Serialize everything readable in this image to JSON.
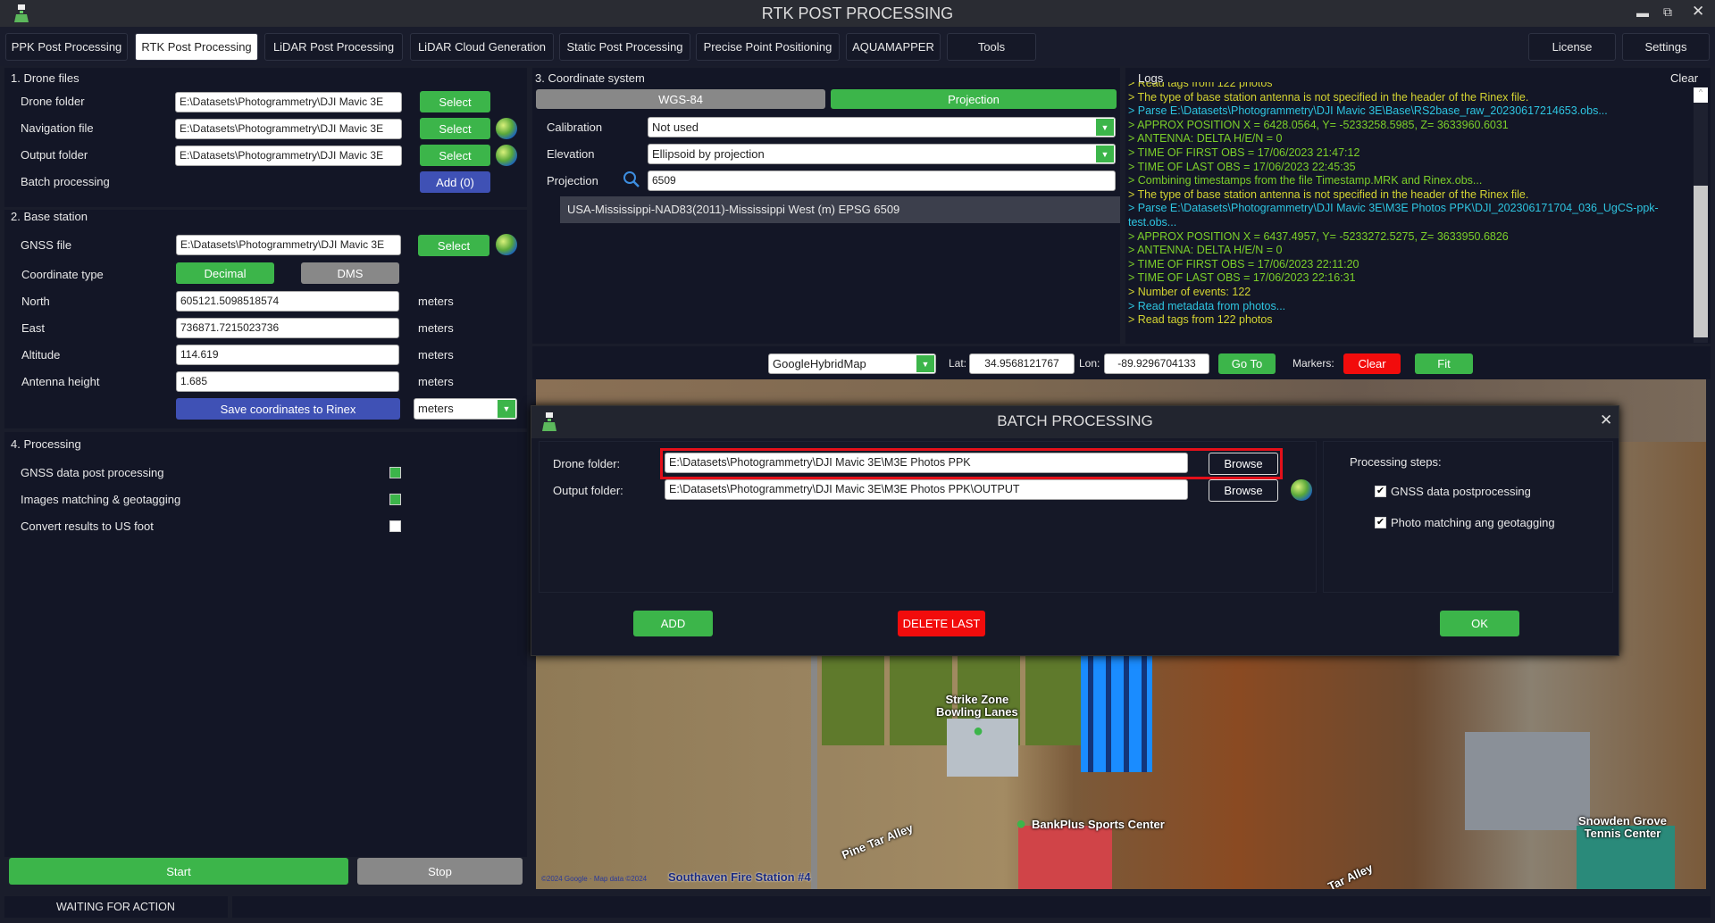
{
  "window": {
    "title": "RTK POST PROCESSING",
    "controls": [
      "minimize",
      "restore",
      "close"
    ]
  },
  "tabs": [
    {
      "label": "PPK Post Processing"
    },
    {
      "label": "RTK Post Processing",
      "active": true
    },
    {
      "label": "LiDAR Post Processing"
    },
    {
      "label": "LiDAR Cloud Generation"
    },
    {
      "label": "Static Post Processing"
    },
    {
      "label": "Precise Point Positioning"
    },
    {
      "label": "AQUAMAPPER"
    },
    {
      "label": "Tools"
    }
  ],
  "right_tabs": {
    "license": "License",
    "settings": "Settings"
  },
  "drone_files": {
    "title": "1. Drone files",
    "drone_folder_label": "Drone folder",
    "drone_folder": "E:\\Datasets\\Photogrammetry\\DJI Mavic 3E",
    "nav_label": "Navigation file",
    "nav_file": "E:\\Datasets\\Photogrammetry\\DJI Mavic 3E",
    "output_label": "Output folder",
    "output_folder": "E:\\Datasets\\Photogrammetry\\DJI Mavic 3E",
    "batch_label": "Batch processing",
    "select": "Select",
    "add": "Add (0)"
  },
  "base_station": {
    "title": "2. Base station",
    "gnss_label": "GNSS file",
    "gnss_file": "E:\\Datasets\\Photogrammetry\\DJI Mavic 3E",
    "select": "Select",
    "coord_type_label": "Coordinate type",
    "decimal": "Decimal",
    "dms": "DMS",
    "north_label": "North",
    "north": "605121.5098518574",
    "east_label": "East",
    "east": "736871.7215023736",
    "alt_label": "Altitude",
    "alt": "114.619",
    "ant_label": "Antenna height",
    "ant": "1.685",
    "unit": "meters",
    "save": "Save coordinates to Rinex",
    "unit_select": "meters"
  },
  "processing": {
    "title": "4. Processing",
    "items": [
      {
        "label": "GNSS data post processing",
        "checked": true
      },
      {
        "label": "Images matching & geotagging",
        "checked": true
      },
      {
        "label": "Convert results to US foot",
        "checked": false
      }
    ],
    "start": "Start",
    "stop": "Stop"
  },
  "status": "WAITING FOR ACTION",
  "coord_system": {
    "title": "3. Coordinate system",
    "wgs": "WGS-84",
    "projection_btn": "Projection",
    "calibration_label": "Calibration",
    "calibration": "Not used",
    "elevation_label": "Elevation",
    "elevation": "Ellipsoid by projection",
    "projection_label": "Projection",
    "projection": "6509",
    "result": "USA-Mississippi-NAD83(2011)-Mississippi West (m) EPSG 6509"
  },
  "logs": {
    "title": "Logs",
    "clear": "Clear",
    "lines": [
      {
        "text": "> Read tags from 122 photos",
        "color": "#d4d432"
      },
      {
        "text": "> The type of base station antenna is not specified in the header of the Rinex file.",
        "color": "#d4d432"
      },
      {
        "text": "> Parse E:\\Datasets\\Photogrammetry\\DJI Mavic 3E\\Base\\RS2base_raw_20230617214653.obs...",
        "color": "#2ec4e0"
      },
      {
        "text": "> APPROX POSITION X = 6428.0564, Y= -5233258.5985, Z= 3633960.6031",
        "color": "#7ccf2a"
      },
      {
        "text": "> ANTENNA: DELTA H/E/N = 0",
        "color": "#7ccf2a"
      },
      {
        "text": "> TIME OF FIRST OBS = 17/06/2023 21:47:12",
        "color": "#7ccf2a"
      },
      {
        "text": "> TIME OF LAST OBS = 17/06/2023 22:45:35",
        "color": "#7ccf2a"
      },
      {
        "text": "> Combining timestamps from the file Timestamp.MRK and Rinex.obs...",
        "color": "#7ccf2a"
      },
      {
        "text": "> The type of base station antenna is not specified in the header of the Rinex file.",
        "color": "#d4d432"
      },
      {
        "text": "> Parse E:\\Datasets\\Photogrammetry\\DJI Mavic 3E\\M3E Photos PPK\\DJI_202306171704_036_UgCS-ppk-",
        "color": "#2ec4e0"
      },
      {
        "text": "test.obs...",
        "color": "#2ec4e0"
      },
      {
        "text": "> APPROX POSITION X = 6437.4957, Y= -5233272.5275, Z= 3633950.6826",
        "color": "#7ccf2a"
      },
      {
        "text": "> ANTENNA: DELTA H/E/N = 0",
        "color": "#7ccf2a"
      },
      {
        "text": "> TIME OF FIRST OBS = 17/06/2023 22:11:20",
        "color": "#7ccf2a"
      },
      {
        "text": "> TIME OF LAST OBS = 17/06/2023 22:16:31",
        "color": "#7ccf2a"
      },
      {
        "text": "> Number of events: 122",
        "color": "#d4d432"
      },
      {
        "text": "> Read metadata from photos...",
        "color": "#2ec4e0"
      },
      {
        "text": "> Read tags from 122 photos",
        "color": "#d4d432"
      }
    ]
  },
  "map_toolbar": {
    "map_type": "GoogleHybridMap",
    "lat_label": "Lat:",
    "lat": "34.9568121767",
    "lon_label": "Lon:",
    "lon": "-89.9296704133",
    "goto": "Go To",
    "markers_label": "Markers:",
    "clear": "Clear",
    "fit": "Fit"
  },
  "map": {
    "labels": [
      "Strike Zone",
      "Bowling Lanes",
      "BankPlus Sports Center",
      "Pine Tar Alley",
      "Tar Alley",
      "Snowden Grove",
      "Tennis Center",
      "Southaven Fire Station #4",
      "©2024 Google · Map data ©2024"
    ]
  },
  "dialog": {
    "title": "BATCH PROCESSING",
    "drone_label": "Drone folder:",
    "drone_folder": "E:\\Datasets\\Photogrammetry\\DJI Mavic 3E\\M3E Photos PPK",
    "output_label": "Output folder:",
    "output_folder": "E:\\Datasets\\Photogrammetry\\DJI Mavic 3E\\M3E Photos PPK\\OUTPUT",
    "browse": "Browse",
    "steps_label": "Processing steps:",
    "steps": [
      {
        "label": "GNSS data postprocessing",
        "checked": true
      },
      {
        "label": "Photo matching ang geotagging",
        "checked": true
      }
    ],
    "add": "ADD",
    "delete_last": "DELETE LAST",
    "ok": "OK"
  }
}
